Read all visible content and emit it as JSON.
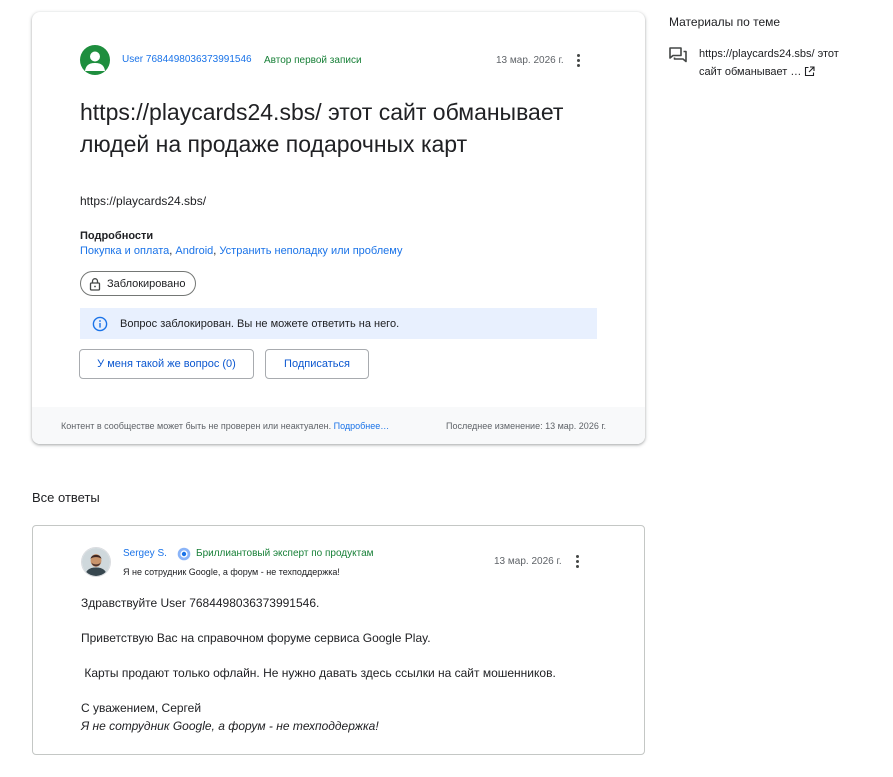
{
  "question": {
    "author": "User 7684498036373991546",
    "author_badge": "Автор первой записи",
    "date": "13 мар. 2026 г.",
    "title": "https://playcards24.sbs/ этот сайт обманывает людей на продаже подарочных карт",
    "body": "https://playcards24.sbs/",
    "details_label": "Подробности",
    "tags": [
      "Покупка и оплата",
      "Android",
      "Устранить неполадку или проблему"
    ],
    "locked_chip": "Заблокировано",
    "locked_notice": "Вопрос заблокирован. Вы не можете ответить на него.",
    "same_question_button": "У меня такой же вопрос (0)",
    "subscribe_button": "Подписаться",
    "footer_disclaimer": "Контент в сообществе может быть не проверен или неактуален.",
    "footer_more_link": "Подробнее…",
    "footer_last_changed": "Последнее изменение: 13 мар. 2026 г."
  },
  "sidebar": {
    "title": "Материалы по теме",
    "related": [
      {
        "text": "https://playcards24.sbs/ этот сайт обманывает …",
        "icon": "forum-icon"
      }
    ]
  },
  "answers": {
    "title": "Все ответы",
    "items": [
      {
        "author": "Sergey S.",
        "badge": "Бриллиантовый эксперт по продуктам",
        "signature": "Я не сотрудник Google, а форум - не техподдержка!",
        "date": "13 мар. 2026 г.",
        "paragraphs": [
          "Здравствуйте User 7684498036373991546.",
          "Приветствую Вас на справочном форуме сервиса Google Play.",
          " Карты продают только офлайн. Не нужно давать здесь ссылки на сайт мошенников.",
          "С уважением, Сергей"
        ],
        "closing_italic": "Я не сотрудник Google, а форум - не техподдержка!"
      }
    ]
  },
  "colors": {
    "link": "#1a73e8",
    "badge_green": "#188038",
    "avatar_green": "#1e8e3e",
    "info_banner_bg": "#e8f0fe",
    "footer_bg": "#f8f9fa"
  }
}
